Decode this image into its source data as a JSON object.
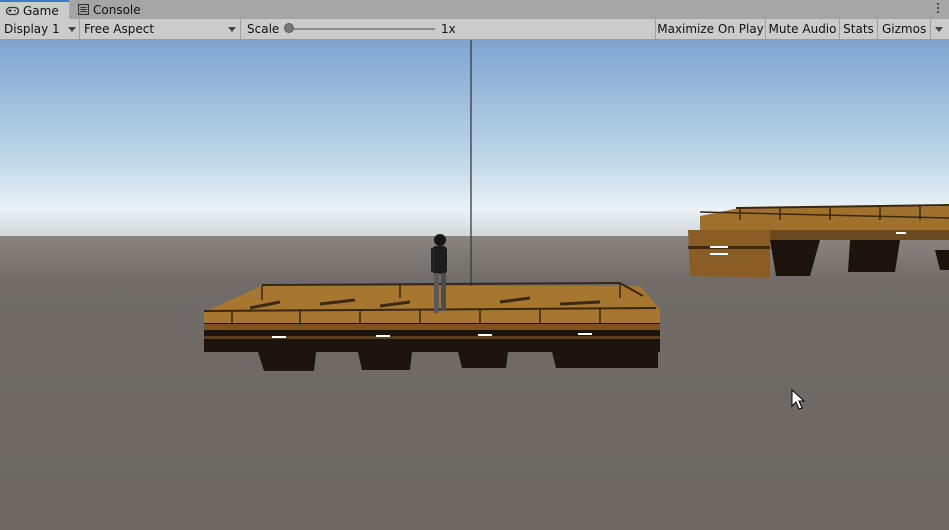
{
  "tabs": [
    {
      "label": "Game",
      "icon": "gamepad-icon",
      "active": true
    },
    {
      "label": "Console",
      "icon": "console-icon",
      "active": false
    }
  ],
  "toolbar": {
    "display_value": "Display 1",
    "aspect_value": "Free Aspect",
    "scale_label": "Scale",
    "scale_value": "1x",
    "scale_fraction": 0.0,
    "maximize_label": "Maximize On Play",
    "mute_label": "Mute Audio",
    "stats_label": "Stats",
    "gizmos_label": "Gizmos"
  },
  "colors": {
    "active_tab_accent": "#3a79d1",
    "sky_top": "#7ea4cf",
    "sky_horizon": "#e8f2f7",
    "ground": "#6e6965",
    "wood": "#9a6a2a"
  },
  "scene": {
    "description_icons": [
      "character-model",
      "wooden-platform",
      "wooden-platform-distant",
      "mouse-cursor-icon"
    ]
  }
}
